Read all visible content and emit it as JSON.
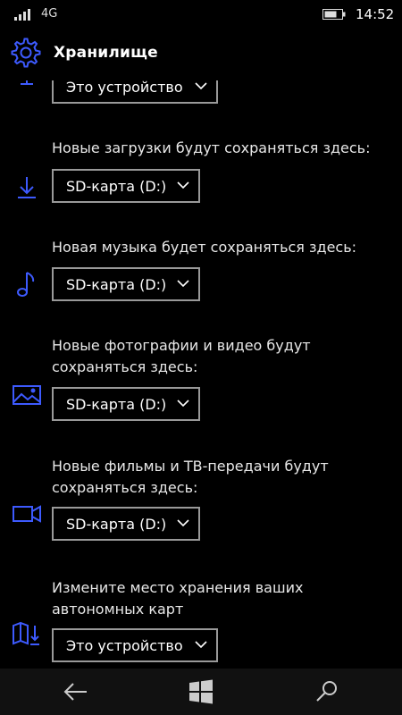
{
  "status_bar": {
    "network": "4G",
    "time": "14:52",
    "icons": [
      "signal-icon",
      "battery-icon"
    ]
  },
  "header": {
    "icon": "gear-icon",
    "title": "Хранилище"
  },
  "sections": [
    {
      "label": "",
      "icon": "monitor-icon",
      "value": "Это устройство"
    },
    {
      "label": "Новые загрузки будут сохраняться здесь:",
      "icon": "download-icon",
      "value": "SD-карта (D:)"
    },
    {
      "label": "Новая музыка будет сохраняться здесь:",
      "icon": "music-note-icon",
      "value": "SD-карта (D:)"
    },
    {
      "label": "Новые фотографии и видео будут сохраняться здесь:",
      "icon": "picture-icon",
      "value": "SD-карта (D:)"
    },
    {
      "label": "Новые фильмы и ТВ-передачи будут сохраняться здесь:",
      "icon": "video-camera-icon",
      "value": "SD-карта (D:)"
    },
    {
      "label": "Измените место хранения ваших автономных карт",
      "icon": "map-download-icon",
      "value": "Это устройство"
    }
  ],
  "nav_bar": {
    "buttons": [
      "back-arrow-icon",
      "windows-start-icon",
      "search-icon"
    ]
  },
  "colors": {
    "accent": "#3D5AFE",
    "background": "#000000",
    "dropdown_border": "#999999"
  }
}
